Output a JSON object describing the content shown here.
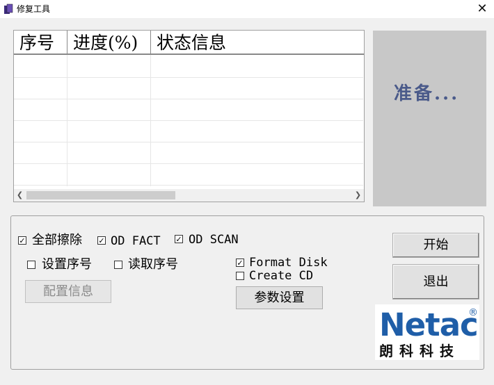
{
  "window": {
    "title": "修复工具",
    "close_symbol": "✕"
  },
  "table": {
    "columns": [
      "序号",
      "进度(%)",
      "状态信息"
    ],
    "rows": []
  },
  "status": {
    "text": "准备..."
  },
  "options": {
    "erase_all": {
      "label": "全部擦除",
      "checked": true
    },
    "od_fact": {
      "label": "OD FACT",
      "checked": true
    },
    "od_scan": {
      "label": "OD SCAN",
      "checked": true
    },
    "set_serial": {
      "label": "设置序号",
      "checked": false
    },
    "read_serial": {
      "label": "读取序号",
      "checked": false
    },
    "format_disk": {
      "label": "Format Disk",
      "checked": true
    },
    "create_cd": {
      "label": "Create CD",
      "checked": false
    }
  },
  "buttons": {
    "config_info": "配置信息",
    "param_settings": "参数设置",
    "start": "开始",
    "exit": "退出"
  },
  "logo": {
    "brand": "Netac",
    "registered": "®",
    "chinese": "朗科科技"
  },
  "colors": {
    "status_text": "#4a5a8a",
    "logo_blue": "#1f5ea8"
  }
}
